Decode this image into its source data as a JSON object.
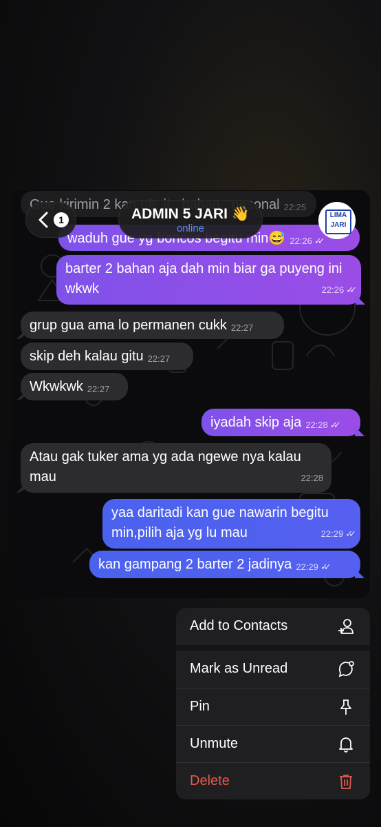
{
  "chat": {
    "title": "ADMIN 5 JARI 👋",
    "status": "online",
    "back_badge": "1",
    "avatar_text": [
      "LIMA",
      "JARI"
    ]
  },
  "messages": [
    {
      "text": "Gue kirimin 2 kan ntr..it.. bahan.. pesonal",
      "time": "22:25",
      "dir": "in"
    },
    {
      "text": "waduh gue yg boncos begitu min😅",
      "time": "22:26",
      "dir": "out"
    },
    {
      "text": "barter 2 bahan aja dah min biar ga puyeng ini wkwk",
      "time": "22:26",
      "dir": "out"
    },
    {
      "text": "grup gua ama lo permanen cukk",
      "time": "22:27",
      "dir": "in"
    },
    {
      "text": "skip deh kalau gitu",
      "time": "22:27",
      "dir": "in"
    },
    {
      "text": "Wkwkwk",
      "time": "22:27",
      "dir": "in"
    },
    {
      "text": "iyadah skip aja",
      "time": "22:28",
      "dir": "out"
    },
    {
      "text": "Atau gak tuker ama yg ada ngewe nya kalau mau",
      "time": "22:28",
      "dir": "in"
    },
    {
      "text": "yaa daritadi kan gue nawarin begitu min,pilih aja yg lu mau",
      "time": "22:29",
      "dir": "out"
    },
    {
      "text": "kan gampang 2 barter 2 jadinya",
      "time": "22:29",
      "dir": "out"
    }
  ],
  "menu": {
    "items": [
      {
        "label": "Add to Contacts",
        "icon": "add-contact-icon"
      },
      {
        "label": "Mark as Unread",
        "icon": "unread-bubble-icon"
      },
      {
        "label": "Pin",
        "icon": "pin-icon"
      },
      {
        "label": "Unmute",
        "icon": "bell-icon"
      },
      {
        "label": "Delete",
        "icon": "trash-icon"
      }
    ]
  },
  "colors": {
    "outgoing_purple": "#8a4fe8",
    "outgoing_blue": "#4a62ee",
    "incoming": "#2c2b2e",
    "online_blue": "#5b8cf5",
    "delete_red": "#e45a4d"
  }
}
